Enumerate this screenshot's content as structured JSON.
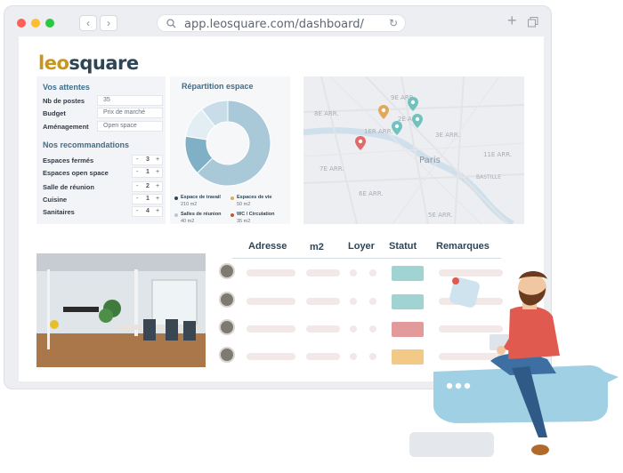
{
  "browser": {
    "url": "app.leosquare.com/dashboard/",
    "back_glyph": "‹",
    "forward_glyph": "›",
    "plus_glyph": "+",
    "reload_glyph": "↻"
  },
  "logo": {
    "part1": "leo",
    "part2": "square",
    "color1": "#c8961f",
    "color2": "#2e4556"
  },
  "attentes": {
    "title": "Vos attentes",
    "rows": [
      {
        "label": "Nb de postes",
        "value": "35"
      },
      {
        "label": "Budget",
        "value": "Prix de marché"
      },
      {
        "label": "Aménagement",
        "value": "Open space"
      }
    ]
  },
  "recommandations": {
    "title": "Nos recommandations",
    "rows": [
      {
        "label": "Espaces fermés",
        "value": "3"
      },
      {
        "label": "Espaces open space",
        "value": "1"
      },
      {
        "label": "Salle de réunion",
        "value": "2"
      },
      {
        "label": "Cuisine",
        "value": "1"
      },
      {
        "label": "Sanitaires",
        "value": "4"
      }
    ],
    "minus": "-",
    "plus": "+"
  },
  "chart_data": {
    "type": "pie",
    "title": "Répartition espace",
    "categories": [
      "Espace de travail",
      "Espaces de vie",
      "Salles de réunion",
      "WC / Circulation"
    ],
    "values": [
      210,
      50,
      40,
      35
    ],
    "units": [
      "210 m2",
      "50 m2",
      "40 m2",
      "35 m2"
    ],
    "colors": [
      "#a9c8d8",
      "#7fb0c6",
      "#e3eef4",
      "#c8dde7"
    ],
    "legend_colors": [
      "#2e4556",
      "#e0a95b",
      "#b9c7d1",
      "#c0593a"
    ]
  },
  "map_labels": [
    "8E ARR.",
    "9E ARR.",
    "2E ARR.",
    "1ER ARR.",
    "3E ARR.",
    "Paris",
    "7E ARR.",
    "11E ARR.",
    "6E ARR.",
    "5E ARR.",
    "BASTILLE"
  ],
  "pin_colors": [
    "#e0a95b",
    "#6fc2bd",
    "#6fc2bd",
    "#6fc2bd",
    "#e06a6a"
  ],
  "table": {
    "headers": [
      "Adresse",
      "m2",
      "Loyer",
      "Statut",
      "Remarques"
    ],
    "statuses": [
      "#9fd4d2",
      "#9fd4d2",
      "#e39a9a",
      "#f2c987"
    ]
  }
}
